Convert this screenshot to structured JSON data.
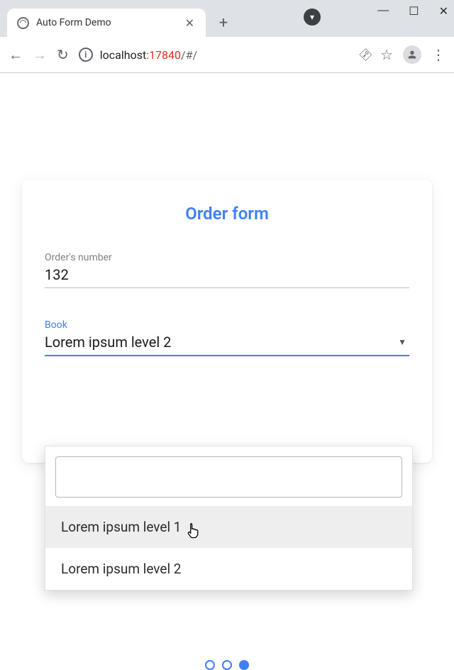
{
  "browser": {
    "tab_title": "Auto Form Demo",
    "url": {
      "host": "localhost",
      "port": ":17840",
      "path": "/#/"
    },
    "window_buttons": {
      "min": "—",
      "max": "☐",
      "close": "✕"
    },
    "newtab": "+",
    "tab_close": "✕",
    "back": "←",
    "forward": "→",
    "reload": "↻",
    "info": "i",
    "key": "⚿",
    "star": "☆",
    "menu": "⋮"
  },
  "form": {
    "title": "Order form",
    "fields": {
      "order_number": {
        "label": "Order's number",
        "value": "132"
      },
      "book": {
        "label": "Book",
        "value": "Lorem ipsum level 2"
      }
    },
    "dropdown": {
      "options": [
        "Lorem ipsum level 1",
        "Lorem ipsum level 2"
      ],
      "hover_index": 0,
      "selected_value": "Lorem ipsum level 2"
    },
    "pager": {
      "count": 3,
      "active_index": 2
    }
  }
}
